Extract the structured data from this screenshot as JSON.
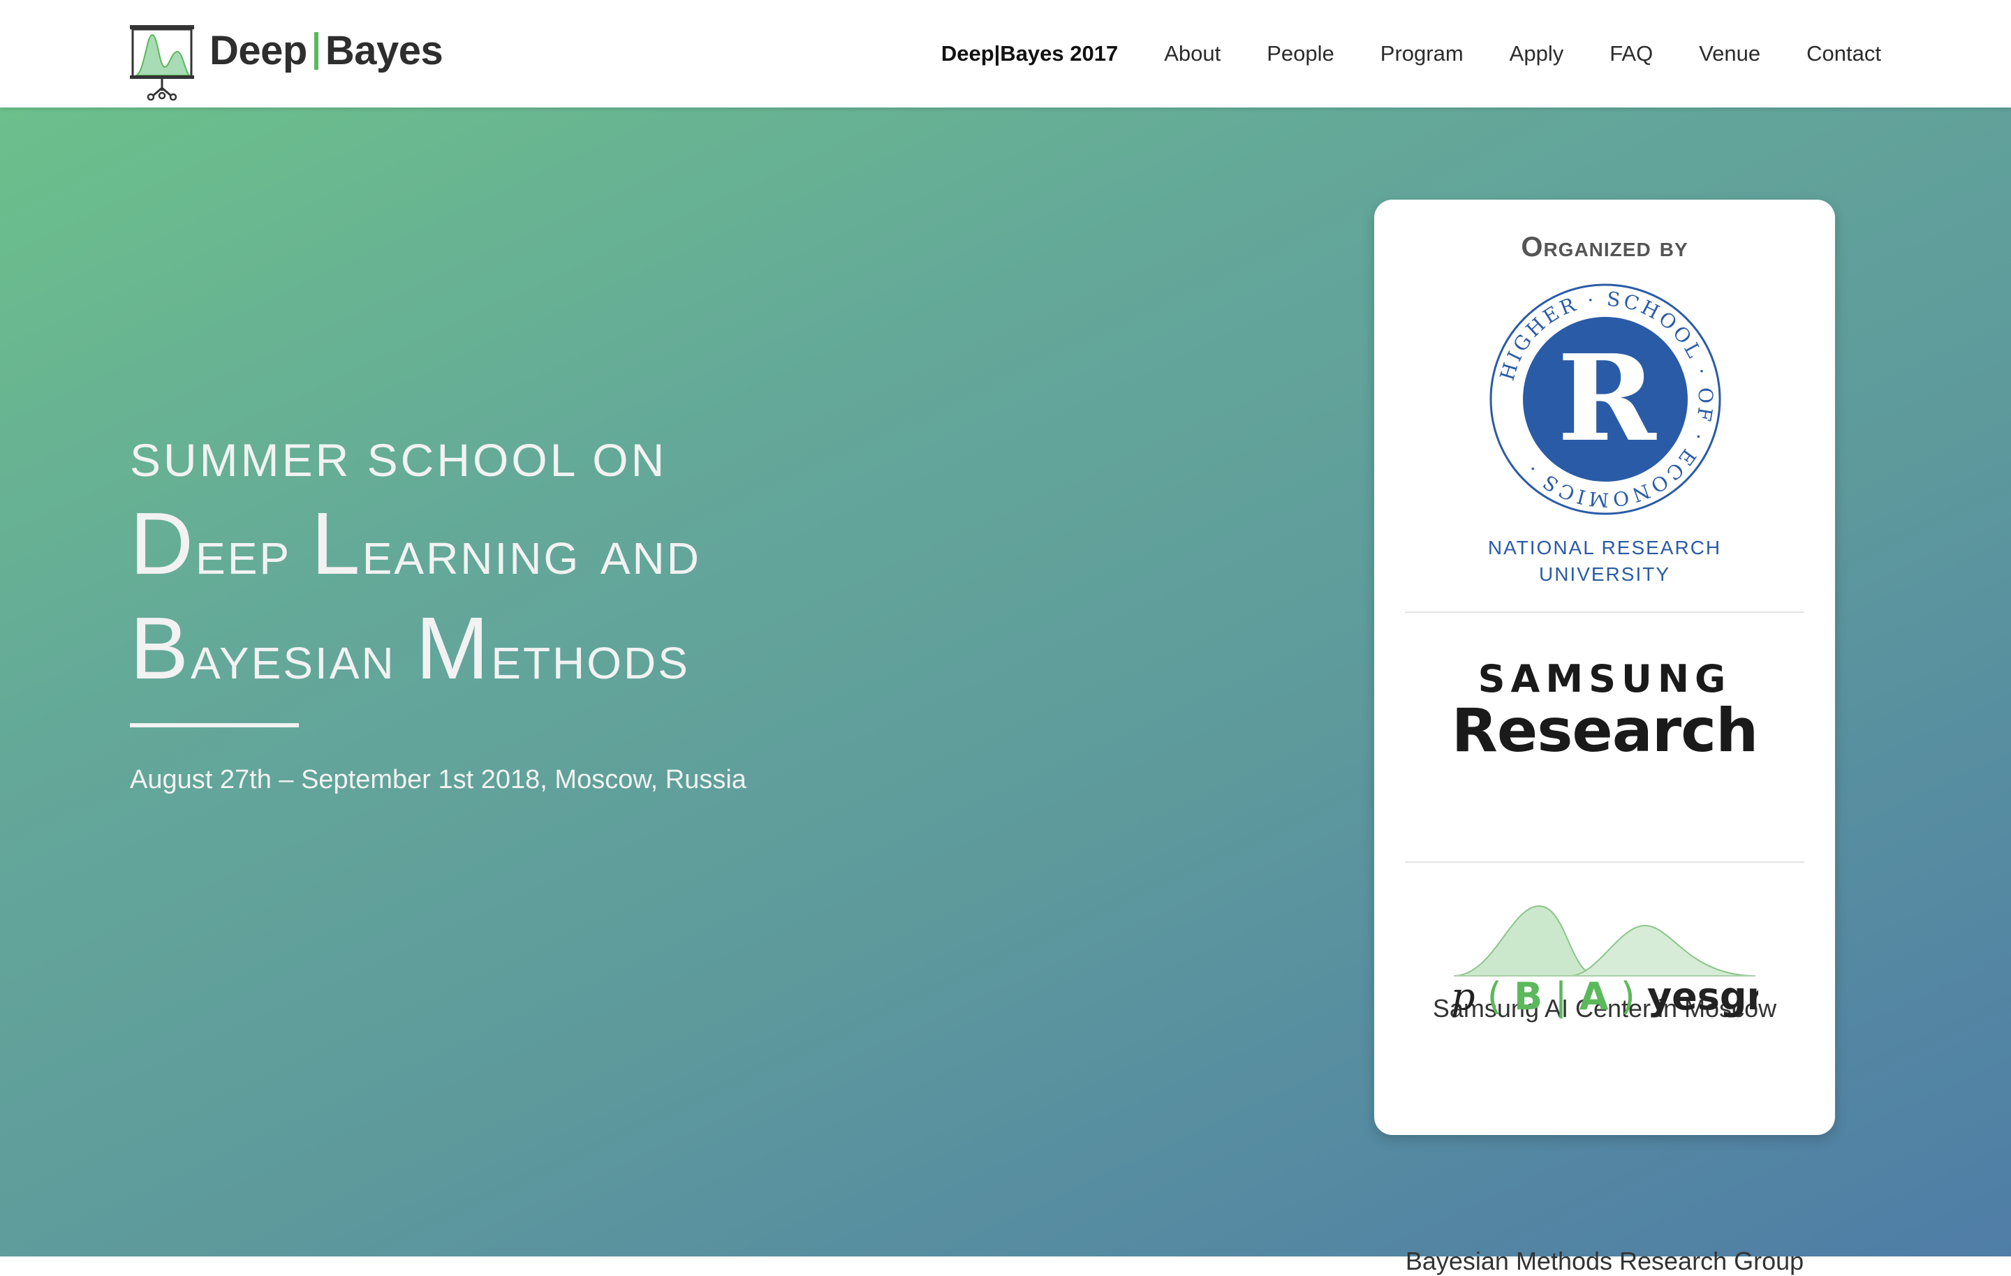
{
  "nav": {
    "brand": {
      "part1": "Deep",
      "part2": "Bayes",
      "logo_icon": "projector-screen-chart-icon"
    },
    "links": [
      {
        "label": "Deep|Bayes 2017",
        "bold": true
      },
      {
        "label": "About"
      },
      {
        "label": "People"
      },
      {
        "label": "Program"
      },
      {
        "label": "Apply"
      },
      {
        "label": "FAQ"
      },
      {
        "label": "Venue"
      },
      {
        "label": "Contact"
      }
    ]
  },
  "hero": {
    "kicker": "SUMMER SCHOOL ON",
    "title_line1_big1": "D",
    "title_line1_rest1": "eep ",
    "title_line1_big2": "L",
    "title_line1_rest2": "earning ",
    "title_line1_and": "and",
    "title_line2_big1": "B",
    "title_line2_rest1": "ayesian ",
    "title_line2_big2": "M",
    "title_line2_rest2": "ethods",
    "date": "August 27th – September 1st 2018, Moscow, Russia"
  },
  "organizers": {
    "title": "Organized by",
    "hse": {
      "seal_text": "HIGHER · SCHOOL · OF · ECONOMICS ·",
      "seal_letter": "R",
      "caption_line1": "NATIONAL RESEARCH",
      "caption_line2": "UNIVERSITY"
    },
    "samsung": {
      "logo_line1": "SAMSUNG",
      "logo_line2": "Research",
      "caption": "Samsung AI Center in Moscow"
    },
    "bayes": {
      "logo_prefix": "p",
      "logo_paren_open": "(",
      "logo_b": "B",
      "logo_bar": "|",
      "logo_a": "A",
      "logo_paren_close": ")",
      "logo_suffix": "yesgroup.ru",
      "caption": "Bayesian Methods Research Group"
    }
  },
  "colors": {
    "accent_green": "#5cb85c",
    "hse_blue": "#2a5ba6",
    "gradient_start": "#6cc08b",
    "gradient_end": "#4f7da6"
  }
}
